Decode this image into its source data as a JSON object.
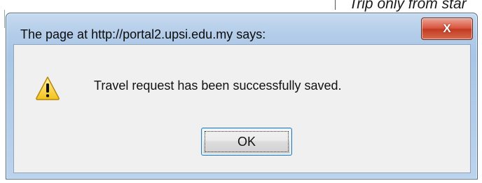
{
  "background": {
    "fragment_text": "Trip only from star"
  },
  "dialog": {
    "title": "The page at http://portal2.upsi.edu.my says:",
    "close_label": "X",
    "icon": "warning-icon",
    "message": "Travel request has been successfully saved.",
    "ok_label": "OK"
  },
  "colors": {
    "frame": "#b4cde9",
    "close_button": "#d9533c",
    "content_bg": "#f0f0f0",
    "ok_focus_border": "#3c7fb1"
  }
}
